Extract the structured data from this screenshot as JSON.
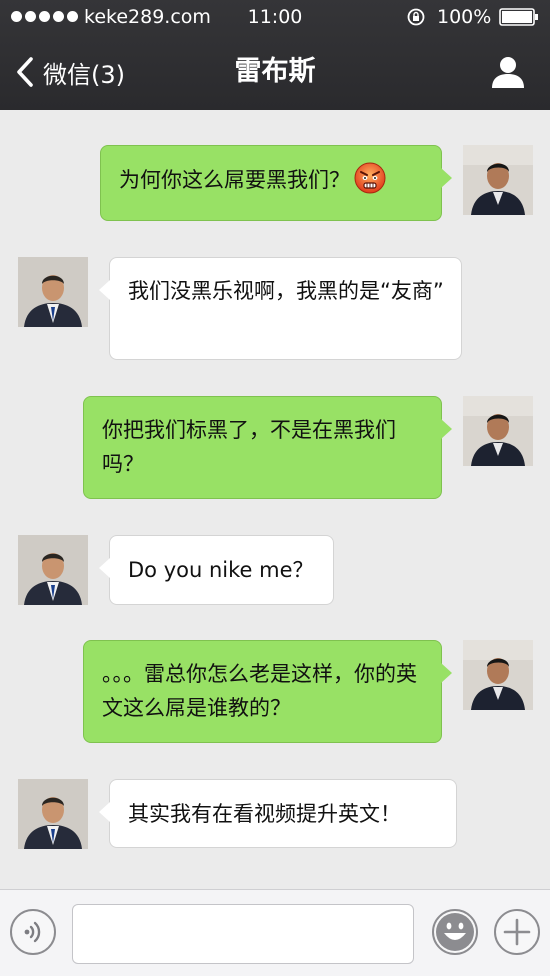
{
  "status_bar": {
    "carrier": "keke289.com",
    "time": "11:00",
    "battery": "100%"
  },
  "nav": {
    "back_label": "微信(3)",
    "title": "雷布斯"
  },
  "messages": [
    {
      "side": "right",
      "sender": "self",
      "text": "为何你这么屌要黑我们？",
      "emoji": "angry-face-emoji"
    },
    {
      "side": "left",
      "sender": "contact",
      "text": "我们没黑乐视啊，我黑的是“友商”"
    },
    {
      "side": "right",
      "sender": "self",
      "text": "你把我们标黑了，不是在黑我们吗？"
    },
    {
      "side": "left",
      "sender": "contact",
      "text": "Do you nike me？"
    },
    {
      "side": "right",
      "sender": "self",
      "text": "。。。雷总你怎么老是这样，你的英文这么屌是谁教的？"
    },
    {
      "side": "left",
      "sender": "contact",
      "text": "其实我有在看视频提升英文！"
    }
  ],
  "input_bar": {
    "message_value": ""
  },
  "colors": {
    "nav_background": "#2f2f32",
    "chat_background": "#ebebeb",
    "sent_bubble": "#98e165",
    "received_bubble": "#ffffff"
  }
}
